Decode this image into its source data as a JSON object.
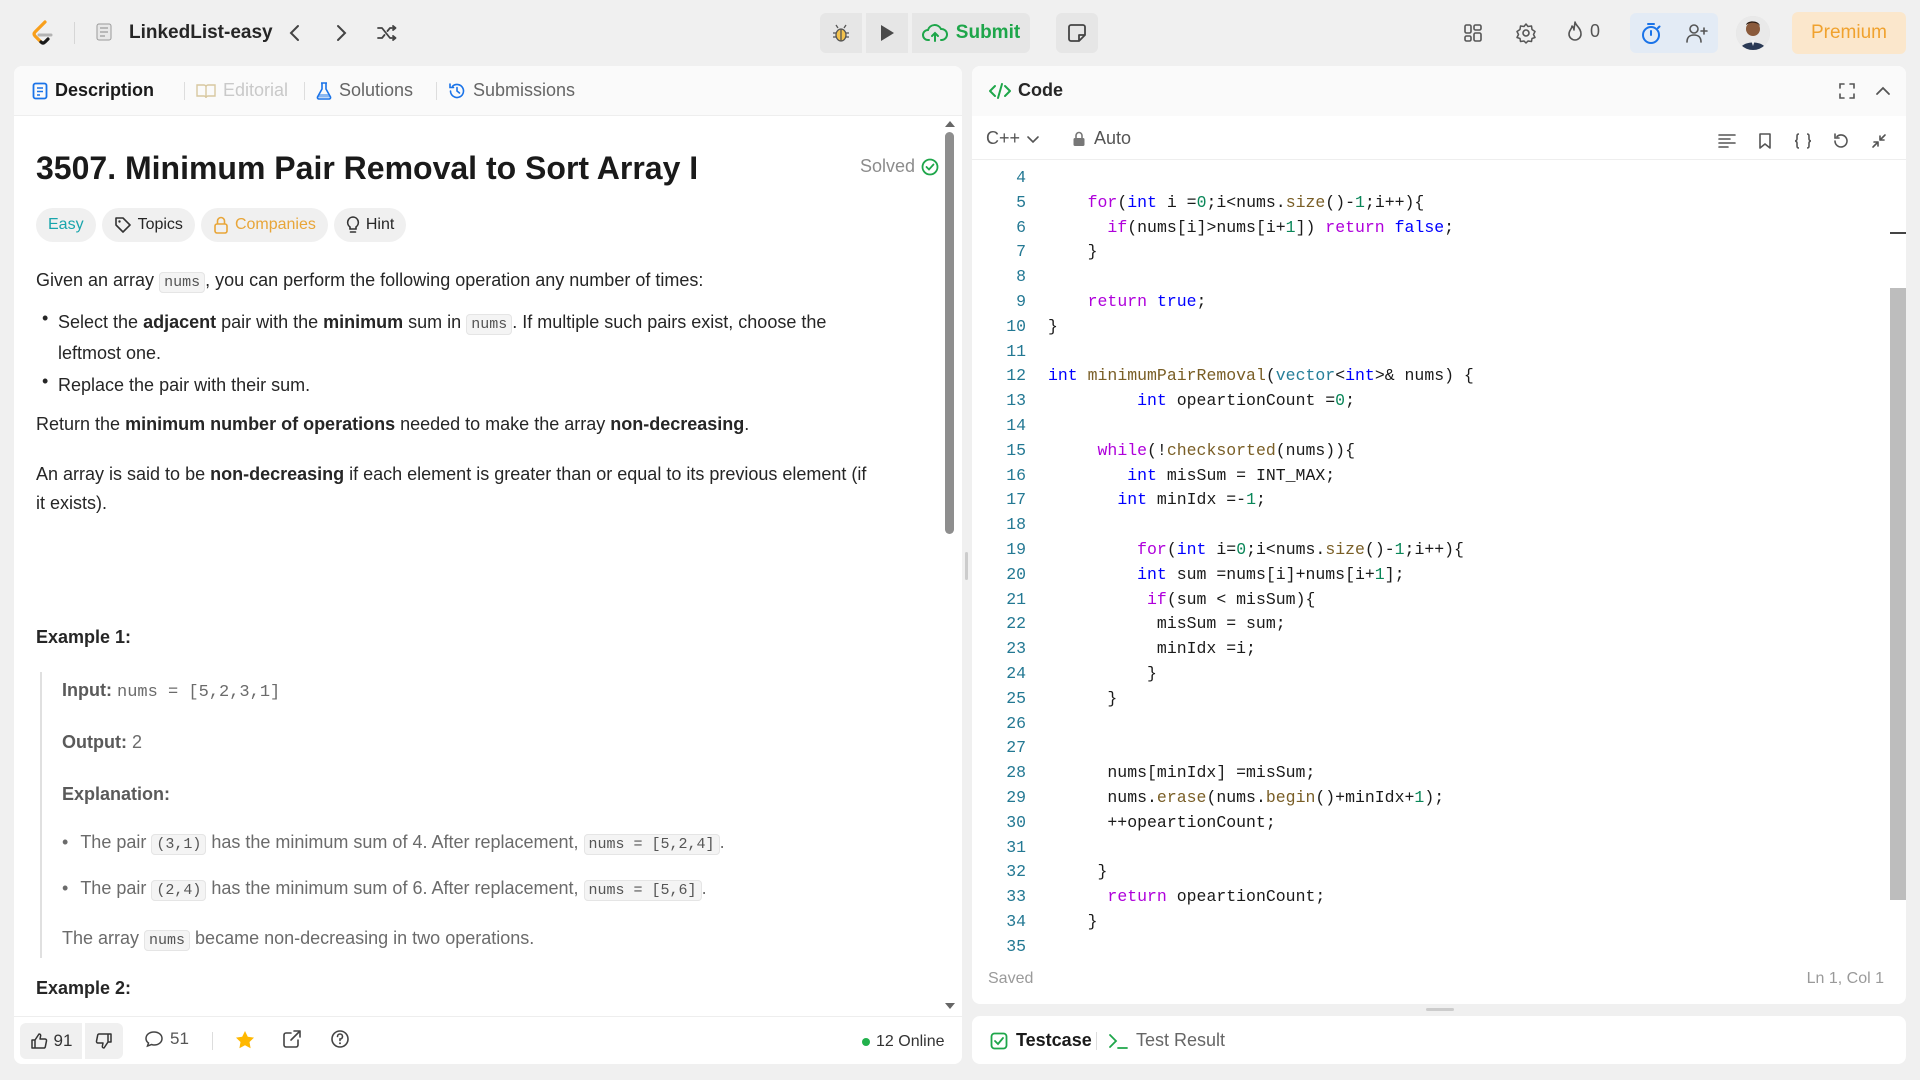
{
  "topbar": {
    "list_title": "LinkedList-easy",
    "submit_label": "Submit",
    "streak_count": "0",
    "premium_label": "Premium"
  },
  "left": {
    "tabs": [
      "Description",
      "Editorial",
      "Solutions",
      "Submissions"
    ],
    "problem_title": "3507. Minimum Pair Removal to Sort Array I",
    "solved_label": "Solved",
    "chips": [
      "Easy",
      "Topics",
      "Companies",
      "Hint"
    ],
    "desc": {
      "p1_a": "Given an array ",
      "p1_code": "nums",
      "p1_b": ", you can perform the following operation any number of times:",
      "b1_a": "Select the ",
      "b1_adj": "adjacent",
      "b1_b": " pair with the ",
      "b1_min": "minimum",
      "b1_c": " sum in ",
      "b1_code": "nums",
      "b1_d": ". If multiple such pairs exist, choose the",
      "b1_e": "leftmost one.",
      "b2": "Replace the pair with their sum.",
      "p2_a": "Return the ",
      "p2_b": "minimum number of operations",
      "p2_c": " needed to make the array ",
      "p2_d": "non-decreasing",
      "p2_e": ".",
      "p3_a": "An array is said to be ",
      "p3_b": "non-decreasing",
      "p3_c": " if each element is greater than or equal to its previous element (if",
      "p3_d": "it exists)."
    },
    "example1": {
      "title": "Example 1:",
      "input_label": "Input:",
      "input_value": "nums = [5,2,3,1]",
      "output_label": "Output:",
      "output_value": "2",
      "explanation_label": "Explanation:",
      "e1_a": "The pair ",
      "e1_code": "(3,1)",
      "e1_b": " has the minimum sum of 4. After replacement, ",
      "e1_code2": "nums = [5,2,4]",
      "e1_c": ".",
      "e2_a": "The pair ",
      "e2_code": "(2,4)",
      "e2_b": " has the minimum sum of 6. After replacement, ",
      "e2_code2": "nums = [5,6]",
      "e2_c": ".",
      "f_a": "The array ",
      "f_code": "nums",
      "f_b": " became non-decreasing in two operations."
    },
    "example2_title": "Example 2:",
    "footer": {
      "likes": "91",
      "comments": "51",
      "online": "12 Online"
    }
  },
  "right": {
    "title": "Code",
    "language": "C++",
    "auto_label": "Auto",
    "saved_label": "Saved",
    "cursor_pos": "Ln 1, Col 1",
    "testcase_label": "Testcase",
    "test_result_label": "Test Result"
  },
  "code_lines": [
    {
      "n": "4",
      "h": ""
    },
    {
      "n": "5",
      "h": "    <span class=\"ctl\">for</span>(<span class=\"kw\">int</span> i =<span class=\"num\">0</span>;i&lt;nums.<span class=\"fn\">size</span>()-<span class=\"num\">1</span>;i++){"
    },
    {
      "n": "6",
      "h": "      <span class=\"ctl\">if</span>(nums[i]&gt;nums[i+<span class=\"num\">1</span>]) <span class=\"ctl\">return</span> <span class=\"kw\">false</span>;"
    },
    {
      "n": "7",
      "h": "    }"
    },
    {
      "n": "8",
      "h": ""
    },
    {
      "n": "9",
      "h": "    <span class=\"ctl\">return</span> <span class=\"kw\">true</span>;"
    },
    {
      "n": "10",
      "h": "}"
    },
    {
      "n": "11",
      "h": ""
    },
    {
      "n": "12",
      "h": "<span class=\"kw\">int</span> <span class=\"fn\">minimumPairRemoval</span>(<span class=\"ty\">vector</span>&lt;<span class=\"kw\">int</span>&gt;&amp; nums) {"
    },
    {
      "n": "13",
      "h": "         <span class=\"kw\">int</span> opeartionCount =<span class=\"num\">0</span>;"
    },
    {
      "n": "14",
      "h": ""
    },
    {
      "n": "15",
      "h": "     <span class=\"ctl\">while</span>(!<span class=\"fn\">checksorted</span>(nums)){"
    },
    {
      "n": "16",
      "h": "        <span class=\"kw\">int</span> misSum = INT_MAX;"
    },
    {
      "n": "17",
      "h": "       <span class=\"kw\">int</span> minIdx =-<span class=\"num\">1</span>;"
    },
    {
      "n": "18",
      "h": ""
    },
    {
      "n": "19",
      "h": "         <span class=\"ctl\">for</span>(<span class=\"kw\">int</span> i=<span class=\"num\">0</span>;i&lt;nums.<span class=\"fn\">size</span>()-<span class=\"num\">1</span>;i++){"
    },
    {
      "n": "20",
      "h": "         <span class=\"kw\">int</span> sum =nums[i]+nums[i+<span class=\"num\">1</span>];"
    },
    {
      "n": "21",
      "h": "          <span class=\"ctl\">if</span>(sum &lt; misSum){"
    },
    {
      "n": "22",
      "h": "           misSum = sum;"
    },
    {
      "n": "23",
      "h": "           minIdx =i;"
    },
    {
      "n": "24",
      "h": "          }"
    },
    {
      "n": "25",
      "h": "      }"
    },
    {
      "n": "26",
      "h": ""
    },
    {
      "n": "27",
      "h": ""
    },
    {
      "n": "28",
      "h": "      nums[minIdx] =misSum;"
    },
    {
      "n": "29",
      "h": "      nums.<span class=\"fn\">erase</span>(nums.<span class=\"fn\">begin</span>()+minIdx+<span class=\"num\">1</span>);"
    },
    {
      "n": "30",
      "h": "      ++opeartionCount;"
    },
    {
      "n": "31",
      "h": ""
    },
    {
      "n": "32",
      "h": "     }"
    },
    {
      "n": "33",
      "h": "      <span class=\"ctl\">return</span> opeartionCount;"
    },
    {
      "n": "34",
      "h": "    }"
    },
    {
      "n": "35",
      "h": ""
    }
  ],
  "colors": {
    "accent_green": "#1ea64a",
    "easy_teal": "#19a5ac",
    "premium_orange": "#f0a22e"
  }
}
